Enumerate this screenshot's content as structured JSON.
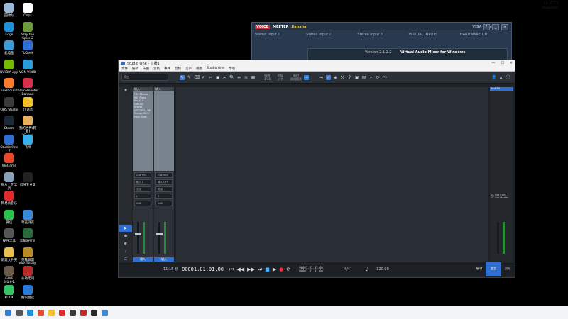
{
  "desktop": {
    "icons": [
      {
        "label": "回收站",
        "color": "#9ab8d8"
      },
      {
        "label": "Oops",
        "color": "#ffffff"
      },
      {
        "label": "Edge",
        "color": "#1f8fd8"
      },
      {
        "label": "Slay the\nSpire 2",
        "color": "#6c9a3e"
      },
      {
        "label": "此电脑",
        "color": "#3c9bd8"
      },
      {
        "label": "ToDesk",
        "color": "#2f6fd4"
      },
      {
        "label": "NVIDIA App",
        "color": "#76b900"
      },
      {
        "label": "VGN VHUB",
        "color": "#2a9dd8"
      },
      {
        "label": "Foxlbound",
        "color": "#ff7a2a"
      },
      {
        "label": "Voicemeeter\nBanana",
        "color": "#d8304a"
      },
      {
        "label": "OBS Studio",
        "color": "#3a3a3a"
      },
      {
        "label": "YY语音",
        "color": "#f2c02a"
      },
      {
        "label": "Steam",
        "color": "#1b2838"
      },
      {
        "label": "我的世界(网易)\nV2.exe",
        "color": "#e8b060"
      },
      {
        "label": "Studio One\n7",
        "color": "#2f6fd4"
      },
      {
        "label": "飞书",
        "color": "#3ab0f0"
      },
      {
        "label": "WeGame",
        "color": "#e84a2a"
      },
      {
        "label": "",
        "color": "#000000"
      },
      {
        "label": "图片上传工具",
        "color": "#8aa0b8"
      },
      {
        "label": "剪映专业版",
        "color": "#222222"
      },
      {
        "label": "网易云音乐",
        "color": "#e22a2a"
      },
      {
        "label": "",
        "color": "#000000"
      },
      {
        "label": "微信",
        "color": "#2ac24a"
      },
      {
        "label": "夸克浏览",
        "color": "#3a8ad8"
      },
      {
        "label": "硬件工具",
        "color": "#555555"
      },
      {
        "label": "三角洲行动",
        "color": "#2a6a3a"
      },
      {
        "label": "新建文件夹",
        "color": "#e8c050"
      },
      {
        "label": "英雄联盟\nWeGame版",
        "color": "#b88a2a"
      },
      {
        "label": "GIMP\n3.0.6-1",
        "color": "#6a5a4a"
      },
      {
        "label": "永劫无间",
        "color": "#b82a2a"
      },
      {
        "label": "KOOK",
        "color": "#3ac46a"
      },
      {
        "label": "腾讯会议",
        "color": "#2a7ad8"
      }
    ]
  },
  "voicemeeter": {
    "brand_voice": "VOICE",
    "brand_meeter": "MEETER",
    "brand_banana": "Banana",
    "inputs": [
      "Stereo Input 1",
      "Stereo Input 2",
      "Stereo Input 3",
      "VIRTUAL INPUTS",
      "HARDWARE OUT"
    ],
    "menu": "Menu",
    "sub_text": "Virtual Audio Mixer for Windows",
    "version": "Version 2.1.2.2",
    "visa_label": "VISA"
  },
  "studio_one": {
    "title": "Studio One - 直播1",
    "menu": [
      "文件",
      "编辑",
      "乐曲",
      "音轨",
      "事件",
      "音频",
      "走带",
      "视图",
      "Studio One",
      "帮助"
    ],
    "window_controls": [
      "—",
      "☐",
      "✕"
    ],
    "toolbar_combo": "开启",
    "snap_label": "吸附",
    "snap_value": "1/16",
    "quantize_label": "时值",
    "quantize_value": "小节",
    "mode_label": "吸附",
    "mode_value": "网格模式",
    "left_icons": [
      "◆",
      "▶",
      "●",
      "◐",
      "♪",
      "☰"
    ],
    "strips": [
      {
        "name": "输入",
        "slots": [
          "FX5 Stereo",
          "MIX Mono",
          "Pro-Q 3",
          "LoFi-Q2 Stereo",
          "VST.DEGA.RE",
          "Reorgt.V2.0",
          "Pitch Shift"
        ],
        "io": "Cue mix",
        "sends": [
          "输入 L",
          "关闭"
        ],
        "pan": "L",
        "gain": "0dB",
        "bottom": "输入"
      },
      {
        "name": "输入",
        "slots": [],
        "io": "Cue mix",
        "sends": [
          "输入 L+R",
          "关闭"
        ],
        "pan": "R",
        "gain": "0dB",
        "bottom": "输入"
      }
    ],
    "right_header": "Inst EX",
    "right_strip": [
      "VC Out L+R",
      "VC Out Master"
    ],
    "transport": {
      "time": "00001.01.01.00",
      "tempo": "11:15 秒",
      "position_a": "00001.01.01.00",
      "position_b": "00001.01.01.00",
      "signature": "4/4",
      "bpm": "120.00",
      "buttons": [
        "⏮",
        "◀◀",
        "▶▶",
        "⏭",
        "■",
        "▶",
        "●"
      ]
    },
    "right_tabs": [
      "编辑",
      "混音",
      "浏览"
    ]
  },
  "taskbar": {
    "icons": [
      {
        "name": "start",
        "color": "#2f7fd8"
      },
      {
        "name": "search",
        "color": "#555555"
      },
      {
        "name": "edge",
        "color": "#1f8fd8"
      },
      {
        "name": "chrome",
        "color": "#e84a2a"
      },
      {
        "name": "explorer",
        "color": "#f2c02a"
      },
      {
        "name": "app1",
        "color": "#e02a2a"
      },
      {
        "name": "app2",
        "color": "#3a3a3a"
      },
      {
        "name": "app3",
        "color": "#c02a2a"
      },
      {
        "name": "app4",
        "color": "#2a2a2a"
      },
      {
        "name": "app5",
        "color": "#3a8ad8"
      }
    ],
    "time": "12:32:13",
    "date": "2026/4/10"
  }
}
